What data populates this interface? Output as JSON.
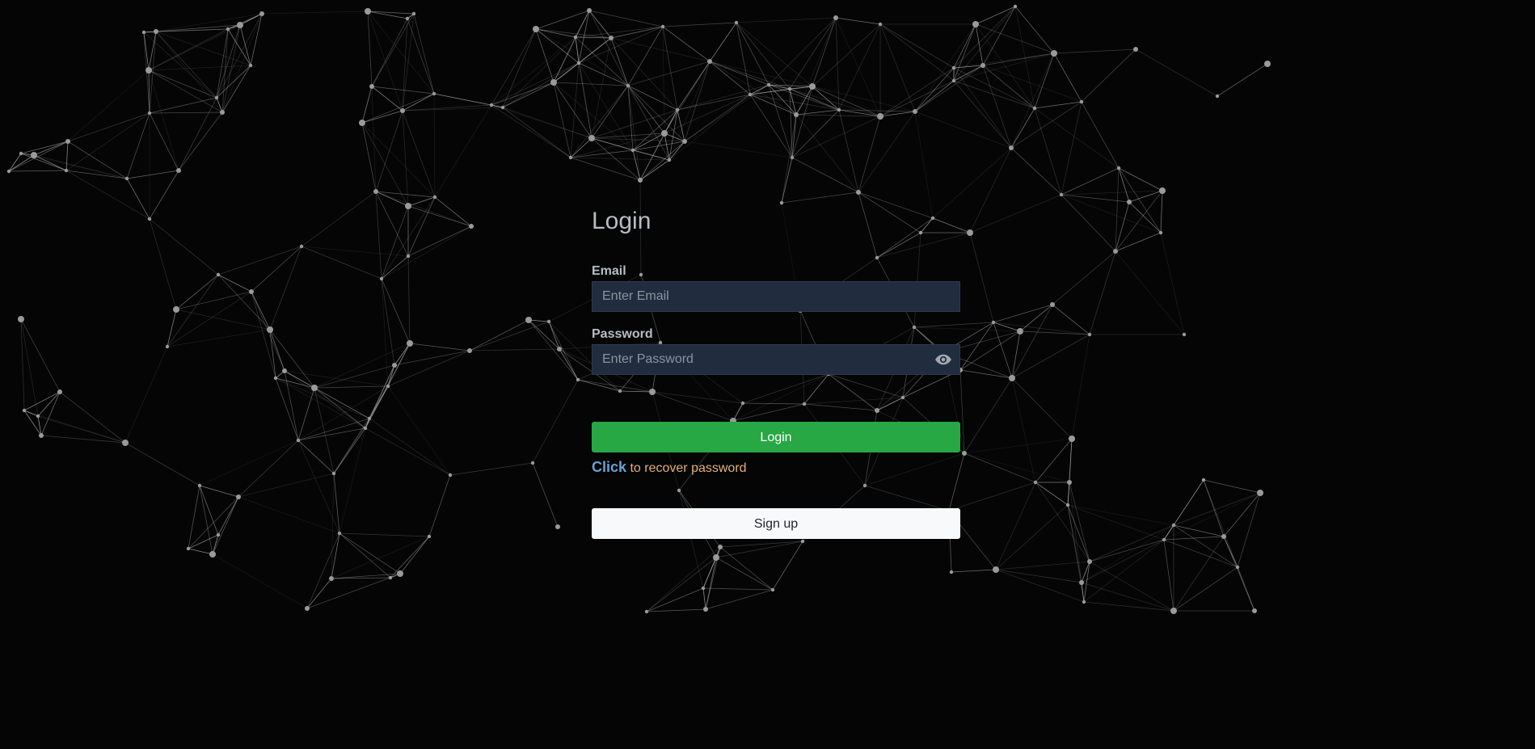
{
  "login": {
    "title": "Login",
    "email_label": "Email",
    "email_placeholder": "Enter Email",
    "email_value": "",
    "password_label": "Password",
    "password_placeholder": "Enter Password",
    "password_value": "",
    "password_toggle_icon": "eye-icon",
    "submit_label": "Login",
    "recover_link": "Click",
    "recover_text": " to recover password",
    "signup_label": "Sign up"
  },
  "colors": {
    "background": "#050505",
    "input_background": "#212d3f",
    "login_button": "#28a745",
    "signup_button": "#f8f9fa",
    "link": "#6a9fd6",
    "recover_text": "#e0b07a",
    "network_lines": "#cfcfcf"
  }
}
